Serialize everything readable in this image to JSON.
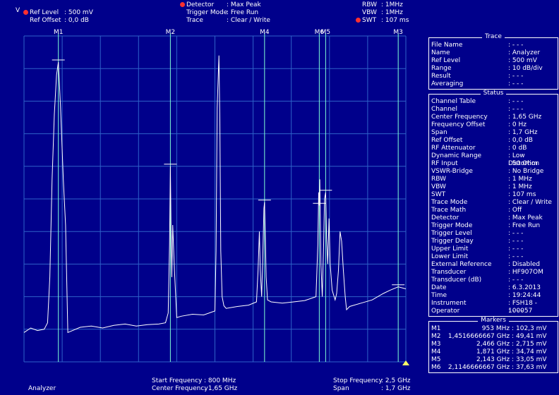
{
  "header": {
    "unit_v": "V",
    "ref_level_label": "Ref Level",
    "ref_level_value": ": 500   mV",
    "ref_offset_label": "Ref Offset",
    "ref_offset_value": ": 0,0 dB",
    "detector_label": "Detector",
    "detector_value": ": Max Peak",
    "trigger_mode_label": "Trigger Mode",
    "trigger_mode_value": ": Free Run",
    "trace_label": "Trace",
    "trace_value": ": Clear / Write",
    "rbw_label": "RBW",
    "rbw_value": ":   1MHz",
    "vbw_label": "VBW",
    "vbw_value": ":   1MHz",
    "swt_label": "SWT",
    "swt_value": ": 107 ms"
  },
  "markers_top": [
    {
      "label": "M1",
      "freq": 953
    },
    {
      "label": "M2",
      "freq": 1451.67
    },
    {
      "label": "M4",
      "freq": 1871
    },
    {
      "label": "M6",
      "freq": 2114.67
    },
    {
      "label": "M5",
      "freq": 2143
    },
    {
      "label": "M3",
      "freq": 2466
    }
  ],
  "colors": {
    "background": "#00008B",
    "grid": "#2E62C8",
    "trace": "#FFFFFF",
    "marker_line": "#7FFFD4",
    "dot": "#FF3030"
  },
  "chart_data": {
    "type": "line",
    "xlim": [
      800,
      2500
    ],
    "ylim": [
      0,
      500
    ],
    "grid": true,
    "series": [
      {
        "x": [
          800,
          830,
          860,
          890,
          905,
          915,
          925,
          935,
          945,
          953,
          962,
          975,
          985,
          995,
          1050,
          1100,
          1150,
          1200,
          1250,
          1300,
          1350,
          1400,
          1430,
          1442,
          1448,
          1451.7,
          1455,
          1458,
          1462,
          1470,
          1480,
          1500,
          1550,
          1600,
          1650,
          1655,
          1660,
          1668,
          1672,
          1676,
          1682,
          1690,
          1700,
          1750,
          1800,
          1835,
          1842,
          1848,
          1852,
          1858,
          1863,
          1868,
          1871,
          1874,
          1878,
          1884,
          1900,
          1950,
          2000,
          2050,
          2100,
          2108,
          2112,
          2114.7,
          2117,
          2122,
          2128,
          2134,
          2138,
          2143,
          2147,
          2152,
          2158,
          2163,
          2172,
          2185,
          2192,
          2200,
          2207,
          2214,
          2222,
          2230,
          2236,
          2250,
          2300,
          2350,
          2400,
          2430,
          2466,
          2500
        ],
        "y": [
          45,
          52,
          48,
          50,
          60,
          130,
          280,
          380,
          440,
          460,
          395,
          280,
          210,
          45,
          53,
          55,
          52,
          56,
          58,
          55,
          57,
          58,
          60,
          75,
          180,
          300,
          200,
          130,
          210,
          140,
          68,
          70,
          73,
          72,
          78,
          170,
          390,
          470,
          370,
          170,
          100,
          86,
          82,
          85,
          87,
          92,
          140,
          200,
          140,
          100,
          160,
          235,
          245,
          200,
          130,
          95,
          92,
          90,
          92,
          94,
          100,
          180,
          260,
          240,
          280,
          150,
          100,
          180,
          250,
          260,
          190,
          150,
          220,
          150,
          110,
          95,
          105,
          140,
          200,
          185,
          140,
          100,
          80,
          85,
          90,
          95,
          105,
          110,
          115,
          112
        ]
      }
    ],
    "x_markers": [
      953,
      1451.67,
      1871,
      2114.67,
      2143,
      2466
    ]
  },
  "trace_panel": {
    "title": "Trace",
    "rows": [
      {
        "k": "File Name",
        "v": ": - - -"
      },
      {
        "k": "Name",
        "v": ": Analyzer"
      },
      {
        "k": "Ref Level",
        "v": ": 500     mV"
      },
      {
        "k": "Range",
        "v": ": 10 dB/div"
      },
      {
        "k": "Result",
        "v": ": - - -"
      },
      {
        "k": "Averaging",
        "v": ": - - -"
      }
    ]
  },
  "status_panel": {
    "title": "Status",
    "rows": [
      {
        "k": "Channel Table",
        "v": ": - - -"
      },
      {
        "k": "Channel",
        "v": ": - - -"
      },
      {
        "k": "Center Frequency",
        "v": ":       1,65 GHz"
      },
      {
        "k": "Frequency Offset",
        "v": ":        0     Hz"
      },
      {
        "k": "Span",
        "v": ":       1,7   GHz"
      },
      {
        "k": "Ref Offset",
        "v": ":       0,0   dB"
      },
      {
        "k": "RF Attenuator",
        "v": ":        0     dB"
      },
      {
        "k": "Dynamic Range",
        "v": ": Low Distortion"
      },
      {
        "k": "RF Input",
        "v": ":       50    Ohm"
      },
      {
        "k": "VSWR-Bridge",
        "v": ": No Bridge"
      },
      {
        "k": "RBW",
        "v": ":        1     MHz"
      },
      {
        "k": "VBW",
        "v": ":        1     MHz"
      },
      {
        "k": "SWT",
        "v": ":       107    ms"
      },
      {
        "k": "Trace Mode",
        "v": ": Clear / Write"
      },
      {
        "k": "Trace Math",
        "v": ": Off"
      },
      {
        "k": "Detector",
        "v": ": Max Peak"
      },
      {
        "k": "Trigger Mode",
        "v": ": Free Run"
      },
      {
        "k": "Trigger Level",
        "v": ": - - -"
      },
      {
        "k": "Trigger Delay",
        "v": ": - - -"
      },
      {
        "k": "Upper Limit",
        "v": ": - - -"
      },
      {
        "k": "Lower Limit",
        "v": ": - - -"
      },
      {
        "k": "External Reference",
        "v": ": Disabled"
      },
      {
        "k": "Transducer",
        "v": ": HF907OM"
      },
      {
        "k": "Transducer (dB)",
        "v": ": - - -"
      },
      {
        "k": "Date",
        "v": ": 6.3.2013"
      },
      {
        "k": "Time",
        "v": ": 19:24:44"
      },
      {
        "k": "Instrument",
        "v": ": FSH18 - 100057"
      },
      {
        "k": "Operator",
        "v": ": - - -"
      }
    ]
  },
  "markers_panel": {
    "title": "Markers",
    "rows": [
      {
        "k": "M1",
        "f": "953 MHz :",
        "l": "102,3 mV"
      },
      {
        "k": "M2",
        "f": "1,4516666667 GHz :",
        "l": "49,41 mV"
      },
      {
        "k": "M3",
        "f": "2,466 GHz :",
        "l": "2,715 mV"
      },
      {
        "k": "M4",
        "f": "1,871 GHz :",
        "l": "34,74 mV"
      },
      {
        "k": "M5",
        "f": "2,143 GHz :",
        "l": "33,05 mV"
      },
      {
        "k": "M6",
        "f": "2,1146666667 GHz :",
        "l": "37,63 mV"
      }
    ]
  },
  "footer": {
    "analyzer": "Analyzer",
    "start_label": "Start Frequency",
    "start_value": ": 800    MHz",
    "center_label": "Center Frequency",
    "center_value": ": 1,65 GHz",
    "stop_label": "Stop Frequency",
    "stop_value": ": 2,5 GHz",
    "span_label": "Span",
    "span_value": ": 1,7 GHz"
  }
}
